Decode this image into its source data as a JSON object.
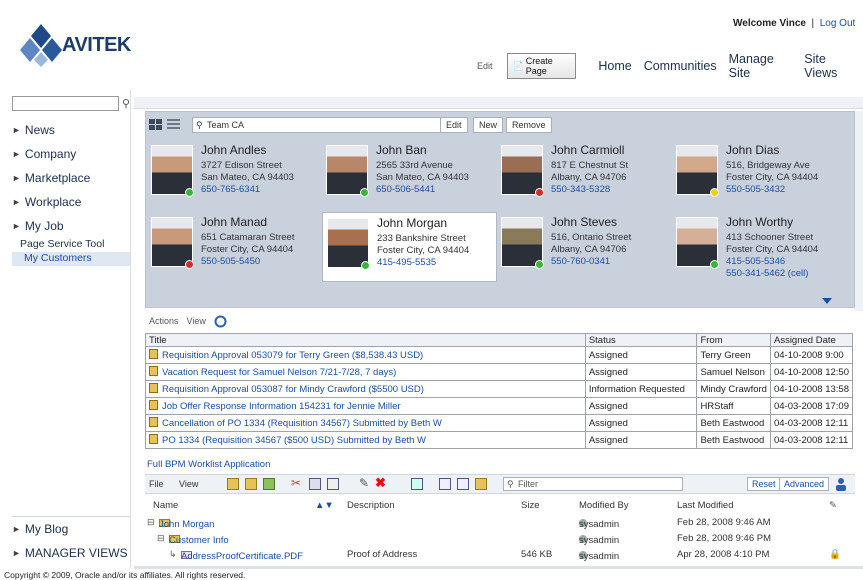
{
  "header": {
    "logo_text": "AVITEK",
    "welcome": "Welcome Vince",
    "logout": "Log Out",
    "edit": "Edit",
    "create_page": "Create Page",
    "nav": [
      "Home",
      "Communities",
      "Manage Site",
      "Site Views"
    ]
  },
  "sidebar": {
    "items": [
      "News",
      "Company",
      "Marketplace",
      "Workplace",
      "My Job"
    ],
    "subitems": [
      "Page Service Tool",
      "My Customers"
    ],
    "bottom_items": [
      "My Blog",
      "MANAGER VIEWS"
    ]
  },
  "people": {
    "search_value": "Team CA",
    "edit": "Edit",
    "new": "New",
    "remove": "Remove",
    "cards": [
      {
        "name": "John Andles",
        "addr1": "3727 Edison Street",
        "addr2": "San Mateo, CA 94403",
        "phone": "650-765-6341",
        "status": "green"
      },
      {
        "name": "John Ban",
        "addr1": "2565 33rd Avenue",
        "addr2": "San Mateo, CA 94403",
        "phone": "650-506-5441",
        "status": "green"
      },
      {
        "name": "John Carmioll",
        "addr1": "817 E Chestnut St",
        "addr2": "Albany, CA 94706",
        "phone": "550-343-5328",
        "status": "red"
      },
      {
        "name": "John Dias",
        "addr1": "516, Bridgeway Ave",
        "addr2": "Foster City, CA 94404",
        "phone": "550-505-3432",
        "status": "yellow"
      },
      {
        "name": "John Manad",
        "addr1": "651 Catamaran Street",
        "addr2": "Foster City, CA 94404",
        "phone": "550-505-5450",
        "status": "red"
      },
      {
        "name": "John Morgan",
        "addr1": "233 Bankshire Street",
        "addr2": "Foster City, CA 94404",
        "phone": "415-495-5535",
        "status": "green"
      },
      {
        "name": "John Steves",
        "addr1": "516, Ontario Street",
        "addr2": "Albany, CA 94706",
        "phone": "550-760-0341",
        "status": "green"
      },
      {
        "name": "John Worthy",
        "addr1": "413 Schooner Street",
        "addr2": "Foster City, CA 94404",
        "phone": "415-505-5346",
        "phone2": "550-341-5462 (cell)",
        "status": "green"
      }
    ]
  },
  "tasks": {
    "actions": "Actions",
    "view": "View",
    "columns": [
      "Title",
      "Status",
      "From",
      "Assigned Date"
    ],
    "rows": [
      {
        "title": "Requisition Approval 053079 for Terry Green ($8,538.43 USD)",
        "status": "Assigned",
        "from": "Terry Green",
        "date": "04-10-2008 9:00"
      },
      {
        "title": "Vacation Request for Samuel Nelson 7/21-7/28, 7 days)",
        "status": "Assigned",
        "from": "Samuel Nelson",
        "date": "04-10-2008 12:50"
      },
      {
        "title": "Requisition Approval 053087 for Mindy Crawford ($5500 USD)",
        "status": "Information Requested",
        "from": "Mindy Crawford",
        "date": "04-10-2008 13:58"
      },
      {
        "title": "Job Offer Response Information 154231 for Jennie Miller",
        "status": "Assigned",
        "from": "HRStaff",
        "date": "04-03-2008 17:09"
      },
      {
        "title": "Cancellation of PO 1334 (Requisition 34567) Submitted by Beth W",
        "status": "Assigned",
        "from": "Beth Eastwood",
        "date": "04-03-2008 12:11"
      },
      {
        "title": "PO 1334 (Requisition 34567 ($500 USD) Submitted by Beth W",
        "status": "Assigned",
        "from": "Beth Eastwood",
        "date": "04-03-2008 12:11"
      }
    ],
    "full_link": "Full BPM Worklist Application"
  },
  "documents": {
    "file": "File",
    "view": "View",
    "filter_placeholder": "Filter",
    "reset": "Reset",
    "advanced": "Advanced",
    "columns": [
      "Name",
      "Description",
      "Size",
      "Modified By",
      "Last Modified"
    ],
    "rows": [
      {
        "name": "John Morgan",
        "desc": "",
        "size": "",
        "by": "sysadmin",
        "date": "Feb 28, 2008 9:46 AM"
      },
      {
        "name": "Customer Info",
        "desc": "",
        "size": "",
        "by": "sysadmin",
        "date": "Feb 28, 2008 9:46 PM"
      },
      {
        "name": "AddressProofCertificate.PDF",
        "desc": "Proof of Address",
        "size": "546 KB",
        "by": "sysadmin",
        "date": "Apr 28, 2008 4:10 PM"
      }
    ]
  },
  "footer": {
    "copyright": "Copyright © 2009, Oracle and/or its affiliates. All rights reserved."
  },
  "colors": {
    "accent": "#1a4d9c",
    "panel": "#c9d1dd",
    "status_green": "#3bb33b",
    "status_red": "#d92b2b",
    "status_yellow": "#e8d21c"
  }
}
